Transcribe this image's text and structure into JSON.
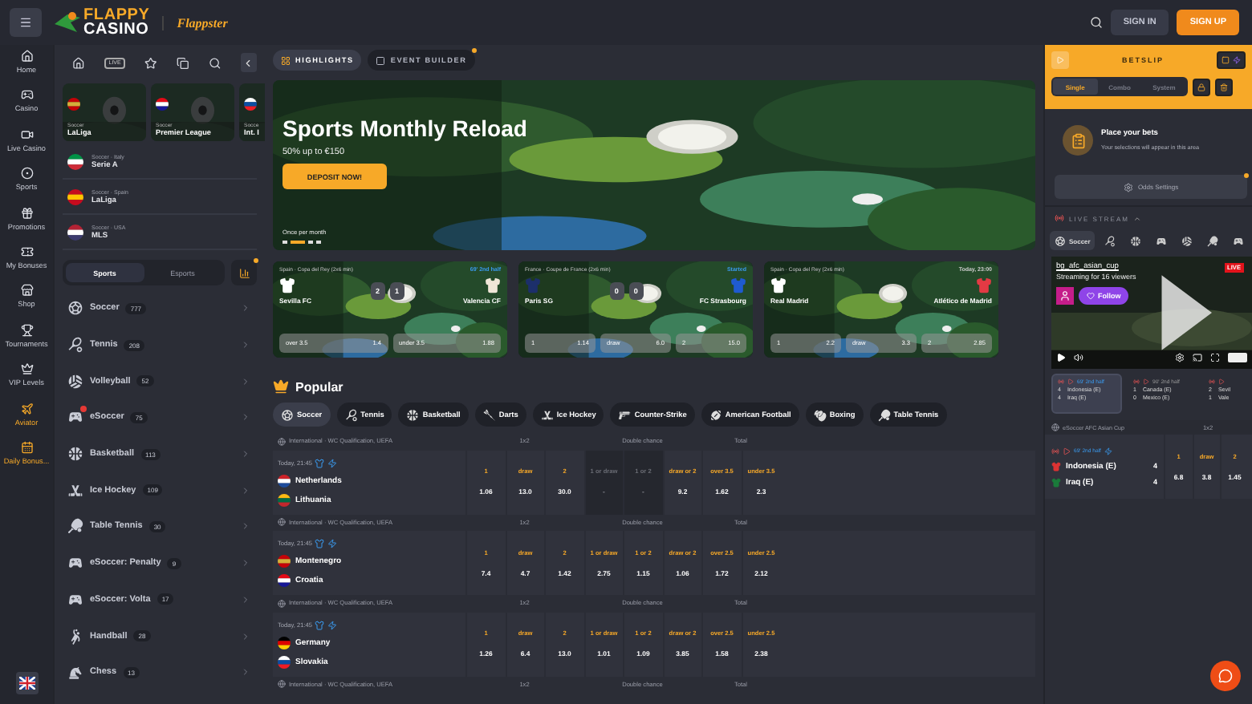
{
  "header": {
    "brand_top": "FLAPPY",
    "brand_bottom": "CASINO",
    "partner": "Flappster",
    "sign_in": "SIGN IN",
    "sign_up": "SIGN UP"
  },
  "nav": [
    {
      "label": "Home",
      "kind": "home",
      "highlighted": false
    },
    {
      "label": "Casino",
      "kind": "casino",
      "highlighted": false
    },
    {
      "label": "Live Casino",
      "kind": "live",
      "highlighted": false
    },
    {
      "label": "Sports",
      "kind": "sports",
      "highlighted": false
    },
    {
      "label": "Promotions",
      "kind": "promo",
      "highlighted": false
    },
    {
      "label": "My Bonuses",
      "kind": "bonus",
      "highlighted": false
    },
    {
      "label": "Shop",
      "kind": "shop",
      "highlighted": false
    },
    {
      "label": "Tournaments",
      "kind": "trophy",
      "highlighted": false
    },
    {
      "label": "VIP Levels",
      "kind": "vip",
      "highlighted": false
    },
    {
      "label": "Aviator",
      "kind": "plane",
      "highlighted": true
    },
    {
      "label": "Daily Bonus...",
      "kind": "calendar",
      "highlighted": true
    }
  ],
  "sidebar": {
    "live_label": "LIVE",
    "featured": [
      {
        "sport": "Soccer",
        "league": "LaLiga"
      },
      {
        "sport": "Soccer",
        "league": "Premier League"
      },
      {
        "sport": "Socce",
        "league": "Int. I"
      }
    ],
    "leagues": [
      {
        "region": "Soccer · Italy",
        "name": "Serie A"
      },
      {
        "region": "Soccer · Spain",
        "name": "LaLiga"
      },
      {
        "region": "Soccer · USA",
        "name": "MLS"
      }
    ],
    "tabs": [
      {
        "label": "Sports",
        "selected": true
      },
      {
        "label": "Esports",
        "selected": false
      }
    ],
    "sports": [
      {
        "name": "Soccer",
        "count": "777",
        "kind": "soccer",
        "notice": false
      },
      {
        "name": "Tennis",
        "count": "208",
        "kind": "tennis",
        "notice": false
      },
      {
        "name": "Volleyball",
        "count": "52",
        "kind": "volleyball",
        "notice": false
      },
      {
        "name": "eSoccer",
        "count": "75",
        "kind": "esoccer",
        "notice": true
      },
      {
        "name": "Basketball",
        "count": "113",
        "kind": "basketball",
        "notice": false
      },
      {
        "name": "Ice Hockey",
        "count": "109",
        "kind": "hockey",
        "notice": false
      },
      {
        "name": "Table Tennis",
        "count": "30",
        "kind": "tabletennis",
        "notice": false
      },
      {
        "name": "eSoccer: Penalty",
        "count": "9",
        "kind": "esoccer",
        "notice": false
      },
      {
        "name": "eSoccer: Volta",
        "count": "17",
        "kind": "esoccer",
        "notice": false
      },
      {
        "name": "Handball",
        "count": "28",
        "kind": "handball",
        "notice": false
      },
      {
        "name": "Chess",
        "count": "13",
        "kind": "chess",
        "notice": false
      }
    ]
  },
  "main": {
    "tabs": [
      {
        "label": "HIGHLIGHTS",
        "selected": true
      },
      {
        "label": "EVENT BUILDER",
        "selected": false
      }
    ],
    "banner": {
      "title": "Sports Monthly Reload",
      "subtitle": "50% up to €150",
      "button": "DEPOSIT NOW!",
      "note": "Once per month",
      "slides": [
        {
          "selected": false
        },
        {
          "selected": true
        },
        {
          "selected": false
        },
        {
          "selected": false
        }
      ]
    },
    "live_cards": [
      {
        "competition": "Spain · Copa del Rey (2x6 min)",
        "status": "69' 2nd half",
        "live": true,
        "home": "Sevilla FC",
        "away": "Valencia CF",
        "score": [
          "2",
          "1"
        ],
        "odds": [
          {
            "label": "over 3.5",
            "value": "1.4"
          },
          {
            "label": "under 3.5",
            "value": "1.88"
          }
        ]
      },
      {
        "competition": "France · Coupe de France (2x6 min)",
        "status": "Started",
        "live": true,
        "home": "Paris SG",
        "away": "FC Strasbourg",
        "score": [
          "0",
          "0"
        ],
        "odds": [
          {
            "label": "1",
            "value": "1.14"
          },
          {
            "label": "draw",
            "value": "6.0"
          },
          {
            "label": "2",
            "value": "15.0"
          }
        ]
      },
      {
        "competition": "Spain · Copa del Rey (2x6 min)",
        "status": "Today, 23:00",
        "live": false,
        "home": "Real Madrid",
        "away": "Atlético de Madrid",
        "odds": [
          {
            "label": "1",
            "value": "2.2"
          },
          {
            "label": "draw",
            "value": "3.3"
          },
          {
            "label": "2",
            "value": "2.85"
          }
        ]
      }
    ],
    "popular": {
      "title": "Popular",
      "sports": [
        {
          "label": "Soccer",
          "kind": "soccer",
          "selected": true
        },
        {
          "label": "Tennis",
          "kind": "tennis",
          "selected": false
        },
        {
          "label": "Basketball",
          "kind": "basketball",
          "selected": false
        },
        {
          "label": "Darts",
          "kind": "darts",
          "selected": false
        },
        {
          "label": "Ice Hockey",
          "kind": "hockey",
          "selected": false
        },
        {
          "label": "Counter-Strike",
          "kind": "shooter",
          "selected": false
        },
        {
          "label": "American Football",
          "kind": "football",
          "selected": false
        },
        {
          "label": "Boxing",
          "kind": "boxing",
          "selected": false
        },
        {
          "label": "Table Tennis",
          "kind": "tabletennis",
          "selected": false
        }
      ]
    },
    "events": [
      {
        "competition": "International · WC Qualification, UEFA",
        "markets": [
          "1x2",
          "Double chance",
          "Total"
        ],
        "time": "Today, 21:45",
        "home": "Netherlands",
        "away": "Lithuania",
        "odds": [
          {
            "label": "1",
            "value": "1.06",
            "disabled": false
          },
          {
            "label": "draw",
            "value": "13.0",
            "disabled": false
          },
          {
            "label": "2",
            "value": "30.0",
            "disabled": false
          },
          {
            "label": "1 or draw",
            "value": "-",
            "disabled": true
          },
          {
            "label": "1 or 2",
            "value": "-",
            "disabled": true
          },
          {
            "label": "draw or 2",
            "value": "9.2",
            "disabled": false
          },
          {
            "label": "over 3.5",
            "value": "1.62",
            "disabled": false
          },
          {
            "label": "under 3.5",
            "value": "2.3",
            "disabled": false
          }
        ]
      },
      {
        "competition": "International · WC Qualification, UEFA",
        "markets": [
          "1x2",
          "Double chance",
          "Total"
        ],
        "time": "Today, 21:45",
        "home": "Montenegro",
        "away": "Croatia",
        "odds": [
          {
            "label": "1",
            "value": "7.4",
            "disabled": false
          },
          {
            "label": "draw",
            "value": "4.7",
            "disabled": false
          },
          {
            "label": "2",
            "value": "1.42",
            "disabled": false
          },
          {
            "label": "1 or draw",
            "value": "2.75",
            "disabled": false
          },
          {
            "label": "1 or 2",
            "value": "1.15",
            "disabled": false
          },
          {
            "label": "draw or 2",
            "value": "1.06",
            "disabled": false
          },
          {
            "label": "over 2.5",
            "value": "1.72",
            "disabled": false
          },
          {
            "label": "under 2.5",
            "value": "2.12",
            "disabled": false
          }
        ]
      },
      {
        "competition": "International · WC Qualification, UEFA",
        "markets": [
          "1x2",
          "Double chance",
          "Total"
        ],
        "time": "Today, 21:45",
        "home": "Germany",
        "away": "Slovakia",
        "odds": [
          {
            "label": "1",
            "value": "1.26",
            "disabled": false
          },
          {
            "label": "draw",
            "value": "6.4",
            "disabled": false
          },
          {
            "label": "2",
            "value": "13.0",
            "disabled": false
          },
          {
            "label": "1 or draw",
            "value": "1.01",
            "disabled": false
          },
          {
            "label": "1 or 2",
            "value": "1.09",
            "disabled": false
          },
          {
            "label": "draw or 2",
            "value": "3.85",
            "disabled": false
          },
          {
            "label": "over 2.5",
            "value": "1.58",
            "disabled": false
          },
          {
            "label": "under 2.5",
            "value": "2.38",
            "disabled": false
          }
        ]
      },
      {
        "competition": "International · WC Qualification, UEFA",
        "markets": [
          "1x2",
          "Double chance",
          "Total"
        ]
      }
    ]
  },
  "betslip": {
    "title": "BETSLIP",
    "modes": [
      {
        "label": "Single",
        "selected": true
      },
      {
        "label": "Combo",
        "selected": false
      },
      {
        "label": "System",
        "selected": false
      }
    ],
    "empty_title": "Place your bets",
    "empty_text": "Your selections will appear in this area",
    "odds_settings": "Odds Settings"
  },
  "live_stream": {
    "title": "LIVE STREAM",
    "filters": [
      {
        "label": "Soccer",
        "kind": "soccer",
        "selected": true
      },
      {
        "kind": "tennis",
        "selected": false
      },
      {
        "kind": "basketball",
        "selected": false
      },
      {
        "kind": "esoccer",
        "selected": false
      },
      {
        "kind": "volleyball",
        "selected": false
      },
      {
        "kind": "tabletennis",
        "selected": false
      },
      {
        "kind": "esoccer",
        "selected": false
      }
    ],
    "channel": "bg_afc_asian_cup",
    "viewers": "Streaming for 16 viewers",
    "badge": "LIVE",
    "follow": "Follow"
  },
  "mini_matches": [
    {
      "status": "69' 2nd half",
      "home": "Indonesia (E)",
      "home_score": "4",
      "away": "Iraq (E)",
      "away_score": "4",
      "selected": true
    },
    {
      "status": "90' 2nd half",
      "home": "Canada (E)",
      "home_score": "1",
      "away": "Mexico (E)",
      "away_score": "0",
      "selected": false
    },
    {
      "home": "Sevil",
      "home_score": "2",
      "away": "Vale",
      "away_score": "1",
      "selected": false
    }
  ],
  "esoccer": {
    "competition": "eSoccer AFC Asian Cup",
    "market": "1x2",
    "status": "69' 2nd half",
    "home": "Indonesia (E)",
    "home_score": "4",
    "away": "Iraq (E)",
    "away_score": "4",
    "odds": [
      {
        "label": "1",
        "value": "6.8"
      },
      {
        "label": "draw",
        "value": "3.8"
      },
      {
        "label": "2",
        "value": "1.45"
      }
    ]
  }
}
